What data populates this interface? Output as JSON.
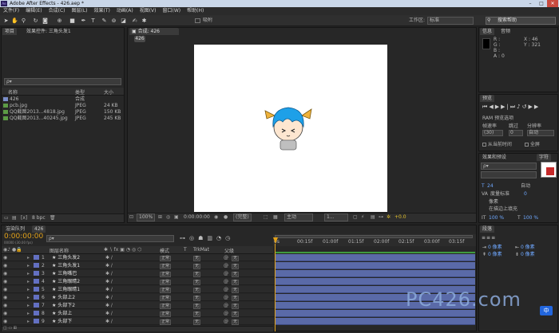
{
  "window": {
    "title": "Adobe After Effects - 426.aep *",
    "app_icon": "Ae",
    "minimize": "–",
    "maximize": "□",
    "close": "✕"
  },
  "menu": [
    "文件(F)",
    "编辑(E)",
    "合成(C)",
    "图层(L)",
    "效果(T)",
    "动画(A)",
    "视图(V)",
    "窗口(W)",
    "帮助(H)"
  ],
  "toolbar": {
    "tool_icons": [
      "select-tool-icon",
      "hand-tool-icon",
      "zoom-tool-icon",
      "rotate-tool-icon",
      "camera-tool-icon",
      "pan-behind-tool-icon",
      "mask-tool-icon",
      "pen-tool-icon",
      "text-tool-icon",
      "brush-tool-icon",
      "clone-tool-icon",
      "eraser-tool-icon",
      "roto-tool-icon",
      "puppet-tool-icon"
    ],
    "snap_label": "吸附",
    "workspace_label": "工作区:",
    "workspace_value": "标准",
    "search_placeholder": "搜索帮助"
  },
  "project": {
    "tab": "项目",
    "effects_tab": "效果控件: 三角头发1",
    "search_placeholder": "ρ▾",
    "columns": [
      "名称",
      "类型",
      "大小"
    ],
    "items": [
      {
        "name": "426",
        "type": "合成",
        "size": ""
      },
      {
        "name": "pcb.jpg",
        "type": "JPEG",
        "size": "24 KB"
      },
      {
        "name": "QQ截图2013...4818.jpg",
        "type": "JPEG",
        "size": "150 KB"
      },
      {
        "name": "QQ截图2013...40245.jpg",
        "type": "JPEG",
        "size": "245 KB"
      }
    ],
    "bpc": "8 bpc"
  },
  "composition": {
    "tab": "合成: 426",
    "crumb": "426",
    "zoom": "100%",
    "timecode": "0:00:00:00",
    "quality": "(完整)",
    "camera": "主动",
    "views": "1...",
    "exposure": "+0.0",
    "canvas_color": "#ffffff",
    "bg_color": "#3a3a3a"
  },
  "info": {
    "tab": "信息",
    "audio_tab": "音频",
    "r": "R :",
    "g": "G :",
    "b": "B :",
    "a": "A : 0",
    "x": "X : 46",
    "y": "Y : 321"
  },
  "preview": {
    "tab": "预览",
    "ram_label": "RAM 预览选项",
    "framerate_label": "帧速率",
    "skip_label": "跳过",
    "resolution_label": "分辨率",
    "framerate_value": "(30)",
    "skip_value": "0",
    "resolution_value": "自动",
    "from_current": "从当前时间",
    "fullscreen": "全屏"
  },
  "effects_presets": {
    "tab": "效果和预设",
    "char_tab": "字符",
    "search_placeholder": "ρ▾"
  },
  "character": {
    "font_size": "24",
    "tracking_label": "VA",
    "leading": "自动",
    "kerning_label": "度量标准",
    "tsume": "0",
    "size_label": "像素",
    "stroke_label": "在描边上填充",
    "scale_v": "100 %",
    "scale_h": "100 %"
  },
  "paragraph": {
    "tab": "段落",
    "indent_left": "0 像素",
    "indent_right": "0 像素",
    "space_before": "0 像素",
    "space_after": "0 像素"
  },
  "timeline": {
    "tabs": [
      "渲染队列",
      "426"
    ],
    "timecode": "0:00:00:00",
    "fps_note": "00000 (30.00 fps)",
    "search_placeholder": "ρ▾",
    "columns": [
      "图层名称",
      "模式",
      "T",
      "TrkMat",
      "父级"
    ],
    "mode_default": "正常",
    "trkmat_default": "无",
    "parent_default": "无",
    "ruler": [
      "0s",
      "00:15f",
      "01:00f",
      "01:15f",
      "02:00f",
      "02:15f",
      "03:00f",
      "03:15f",
      "04:00f"
    ],
    "layers": [
      {
        "num": "1",
        "name": "三角头发2"
      },
      {
        "num": "2",
        "name": "三角头发1"
      },
      {
        "num": "3",
        "name": "三角嘴巴"
      },
      {
        "num": "4",
        "name": "三角眼睛2"
      },
      {
        "num": "5",
        "name": "三角眼睛1"
      },
      {
        "num": "6",
        "name": "头部上2"
      },
      {
        "num": "7",
        "name": "头部下2"
      },
      {
        "num": "8",
        "name": "头部上"
      },
      {
        "num": "9",
        "name": "头部下"
      }
    ],
    "track_color": "#5a6aa8",
    "bottom_label": "切换开关 / 模式"
  },
  "watermark": {
    "text": "PC426.com",
    "lang": "中"
  }
}
